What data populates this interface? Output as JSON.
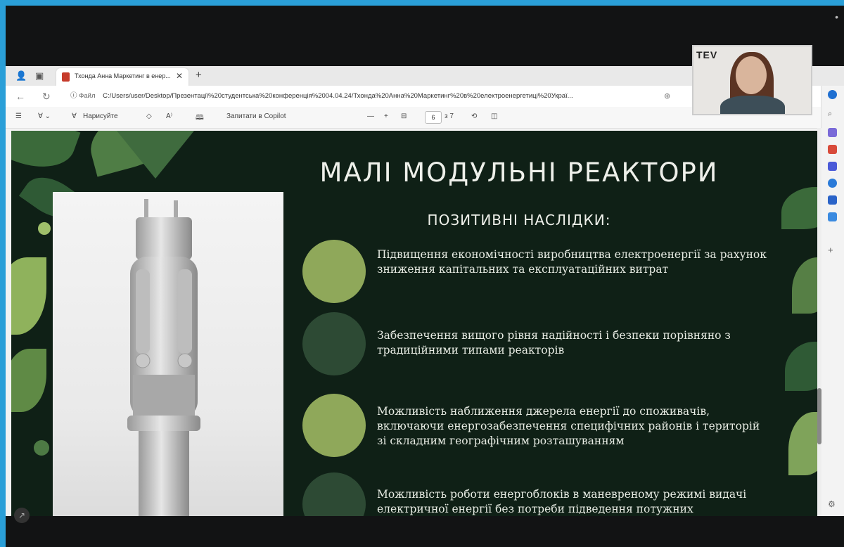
{
  "browser": {
    "tab_title": "Тхонда Анна Маркетинг в енер...",
    "url_label": "Файл",
    "url": "C:/Users/user/Desktop/Презентації%20студентська%20конференція%2004.04.24/Тхонда%20Анна%20Маркетинг%20в%20електроенергетиці%20Украї...",
    "draw_label": "Нарисуйте",
    "ask_copilot": "Запитати в Copilot",
    "page_current": "6",
    "page_total": "з 7"
  },
  "slide": {
    "title": "МАЛІ МОДУЛЬНІ РЕАКТОРИ",
    "subtitle": "ПОЗИТИВНІ НАСЛІДКИ:",
    "bullets": [
      "Підвищення економічності виробництва електроенергії за рахунок зниження капітальних та експлуатаційних витрат",
      "Забезпечення вищого рівня надійності і безпеки порівняно з традиційними типами реакторів",
      "Можливість наближення джерела енергії до споживачів, включаючи енергозабезпечення специфічних районів і територій зі складним географічним розташуванням",
      "Можливість роботи енергоблоків в маневреному режимі видачі електричної енергії без потреби підведення потужних"
    ]
  },
  "video": {
    "logo_text": "TEV"
  },
  "colors": {
    "slide_bg": "#0f2016",
    "circle_light": "#8fa85a",
    "circle_dark": "#2d4a34",
    "frame": "#2a9fd8"
  }
}
